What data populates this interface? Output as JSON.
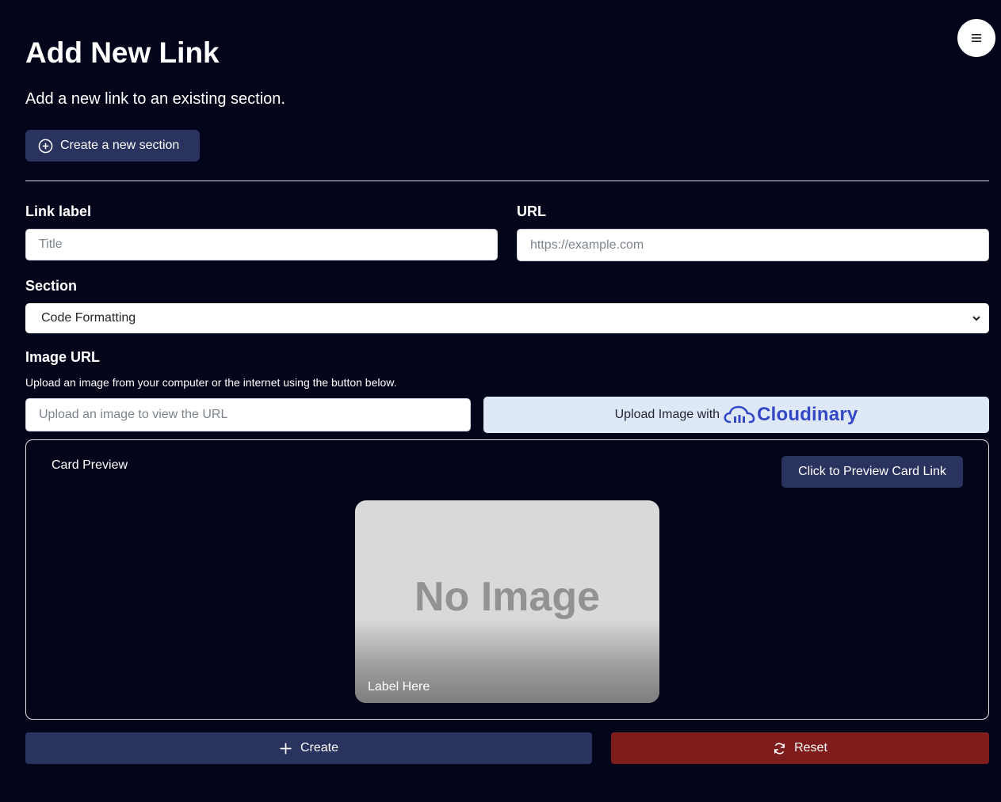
{
  "header": {
    "title": "Add New Link",
    "subtitle": "Add a new link to an existing section.",
    "new_section_button": "Create a new section",
    "menu_icon": "hamburger-icon"
  },
  "form": {
    "link_label": {
      "label": "Link label",
      "placeholder": "Title",
      "value": ""
    },
    "url": {
      "label": "URL",
      "placeholder": "https://example.com",
      "value": ""
    },
    "section": {
      "label": "Section",
      "selected": "Code Formatting"
    },
    "image_url": {
      "label": "Image URL",
      "hint": "Upload an image from your computer or the internet using the button below.",
      "placeholder": "Upload an image to view the URL",
      "value": "",
      "upload_button_text": "Upload Image with",
      "upload_brand": "Cloudinary"
    }
  },
  "preview": {
    "title": "Card Preview",
    "preview_button": "Click to Preview Card Link",
    "card_image_text": "No Image",
    "card_label": "Label Here"
  },
  "actions": {
    "create_label": "Create",
    "reset_label": "Reset"
  },
  "colors": {
    "background": "#03061a",
    "primary_button": "#2a325e",
    "danger_button": "#7f1d1d",
    "upload_button": "#dfe8f7",
    "cloudinary_brand": "#3448c5"
  }
}
